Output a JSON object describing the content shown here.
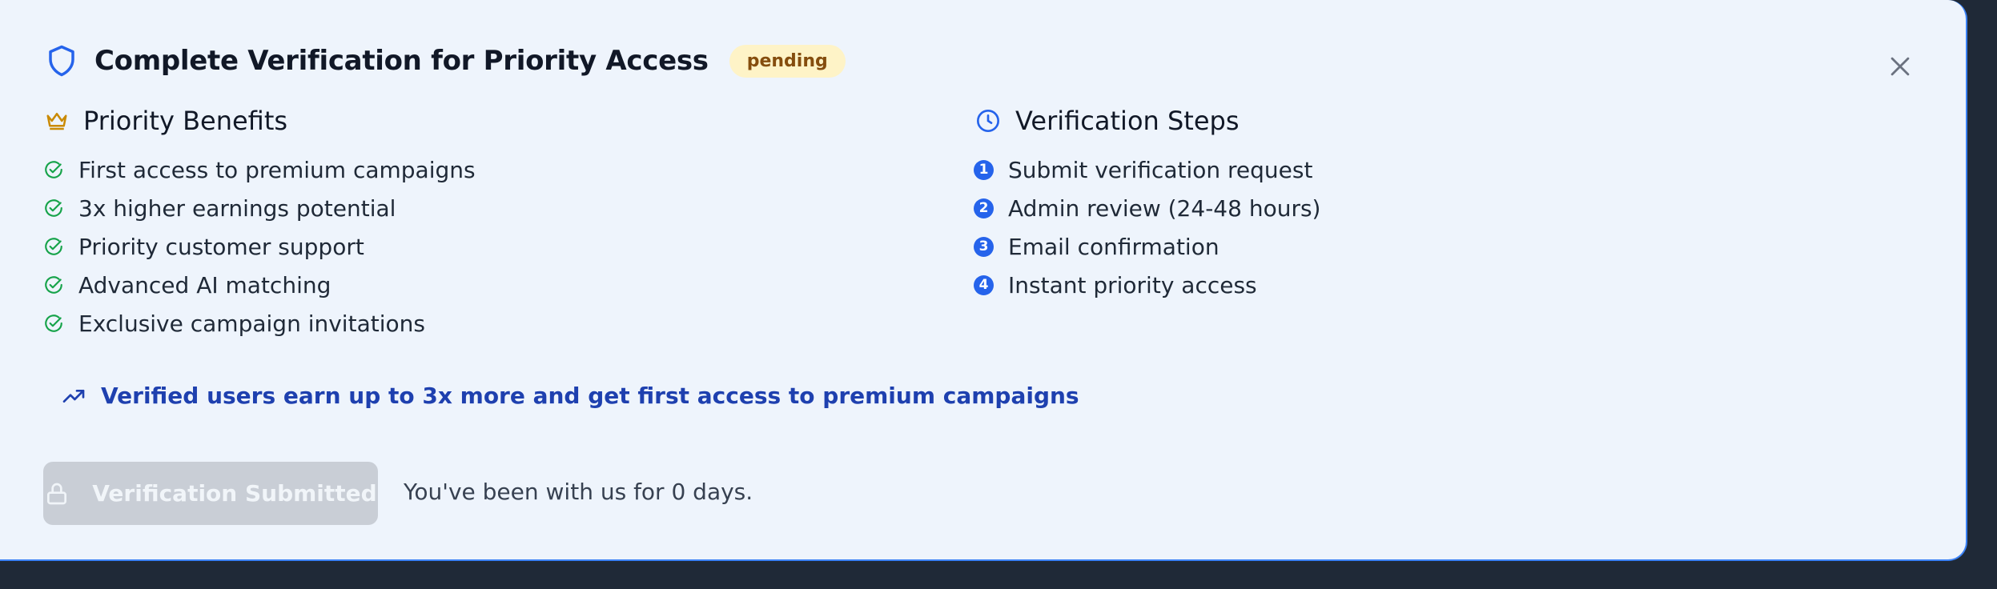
{
  "modal": {
    "title": "Complete Verification for Priority Access",
    "status_badge": "pending",
    "close_icon": "close-icon",
    "shield_icon": "shield-icon"
  },
  "benefits": {
    "heading": "Priority Benefits",
    "icon": "crown-icon",
    "items": [
      "First access to premium campaigns",
      "3x higher earnings potential",
      "Priority customer support",
      "Advanced AI matching",
      "Exclusive campaign invitations"
    ]
  },
  "steps": {
    "heading": "Verification Steps",
    "icon": "clock-icon",
    "items": [
      {
        "number": "1",
        "label": "Submit verification request"
      },
      {
        "number": "2",
        "label": "Admin review (24-48 hours)"
      },
      {
        "number": "3",
        "label": "Email confirmation"
      },
      {
        "number": "4",
        "label": "Instant priority access"
      }
    ]
  },
  "promo": {
    "icon": "trending-up-icon",
    "text": "Verified users earn up to 3x more and get first access to premium campaigns"
  },
  "footer": {
    "button_label": "Verification Submitted",
    "button_icon": "lock-icon",
    "tenure_text": "You've been with us for 0 days."
  },
  "colors": {
    "accent": "#2563eb",
    "success": "#16a34a",
    "badge_bg": "#fef3c7",
    "promo_text": "#1e40af",
    "crown": "#ca8a04"
  }
}
